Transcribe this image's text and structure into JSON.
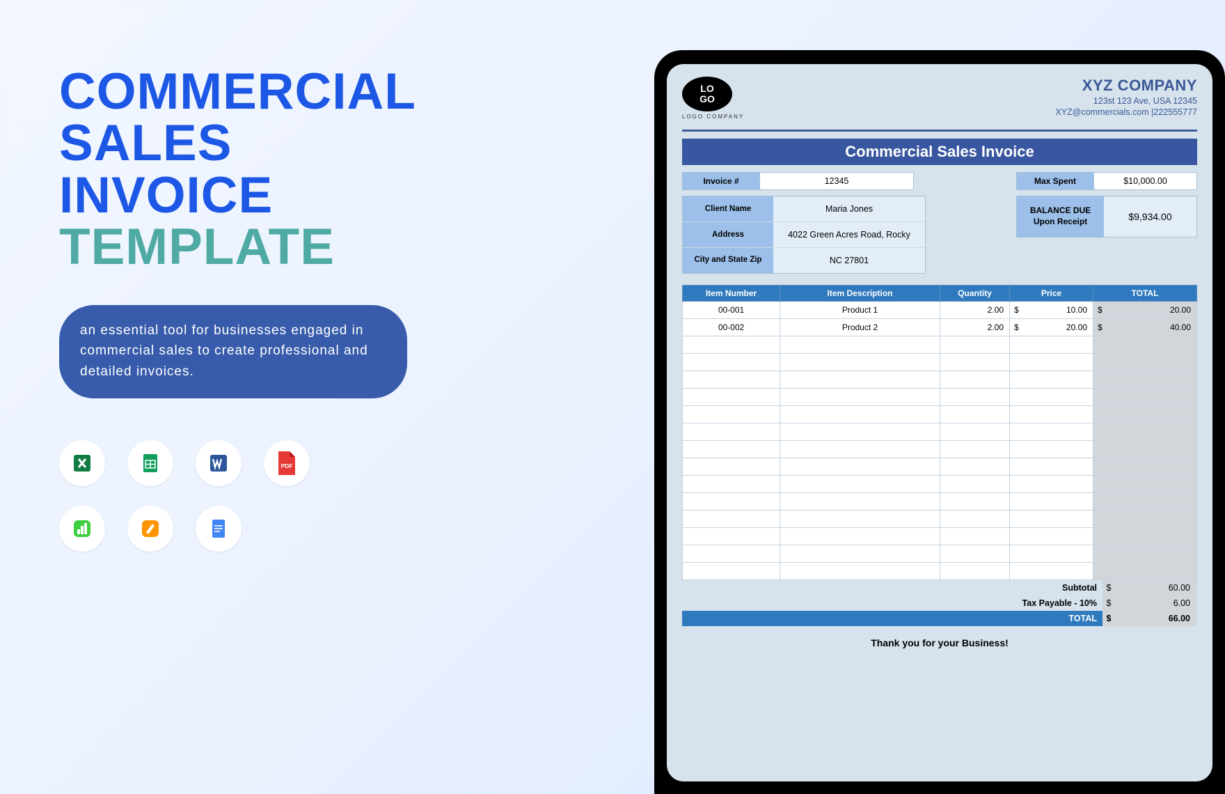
{
  "left": {
    "title_lines": [
      "COMMERCIAL",
      "SALES",
      "INVOICE"
    ],
    "title_teal": "TEMPLATE",
    "pill": "an essential tool for businesses engaged in commercial sales to create professional and detailed invoices."
  },
  "icons": [
    {
      "name": "excel-icon"
    },
    {
      "name": "sheets-icon"
    },
    {
      "name": "word-icon"
    },
    {
      "name": "pdf-icon"
    },
    {
      "name": "numbers-icon"
    },
    {
      "name": "pages-icon"
    },
    {
      "name": "docs-icon"
    }
  ],
  "invoice": {
    "logo_text": "LO\nGO",
    "logo_sub": "LOGO COMPANY",
    "company_name": "XYZ COMPANY",
    "company_addr": "123st 123 Ave, USA 12345",
    "company_contact": "XYZ@commercials.com |222555777",
    "title_bar": "Commercial Sales Invoice",
    "labels": {
      "invoice_no": "Invoice #",
      "max_spent": "Max Spent",
      "client_name": "Client Name",
      "address": "Address",
      "city_zip": "City and State Zip",
      "balance_due1": "BALANCE DUE",
      "balance_due2": "Upon Receipt"
    },
    "values": {
      "invoice_no": "12345",
      "max_spent": "$10,000.00",
      "client_name": "Maria Jones",
      "address": "4022 Green Acres Road, Rocky",
      "city_zip": "NC 27801",
      "balance_due": "$9,934.00"
    },
    "table": {
      "headers": [
        "Item Number",
        "Item Description",
        "Quantity",
        "Price",
        "TOTAL"
      ],
      "rows": [
        {
          "num": "00-001",
          "desc": "Product 1",
          "qty": "2.00",
          "price": "10.00",
          "total": "20.00"
        },
        {
          "num": "00-002",
          "desc": "Product 2",
          "qty": "2.00",
          "price": "20.00",
          "total": "40.00"
        }
      ],
      "empty_rows": 14
    },
    "totals": {
      "subtotal_label": "Subtotal",
      "subtotal": "60.00",
      "tax_label": "Tax Payable - 10%",
      "tax": "6.00",
      "total_label": "TOTAL",
      "total": "66.00"
    },
    "thanks": "Thank you for your Business!"
  }
}
